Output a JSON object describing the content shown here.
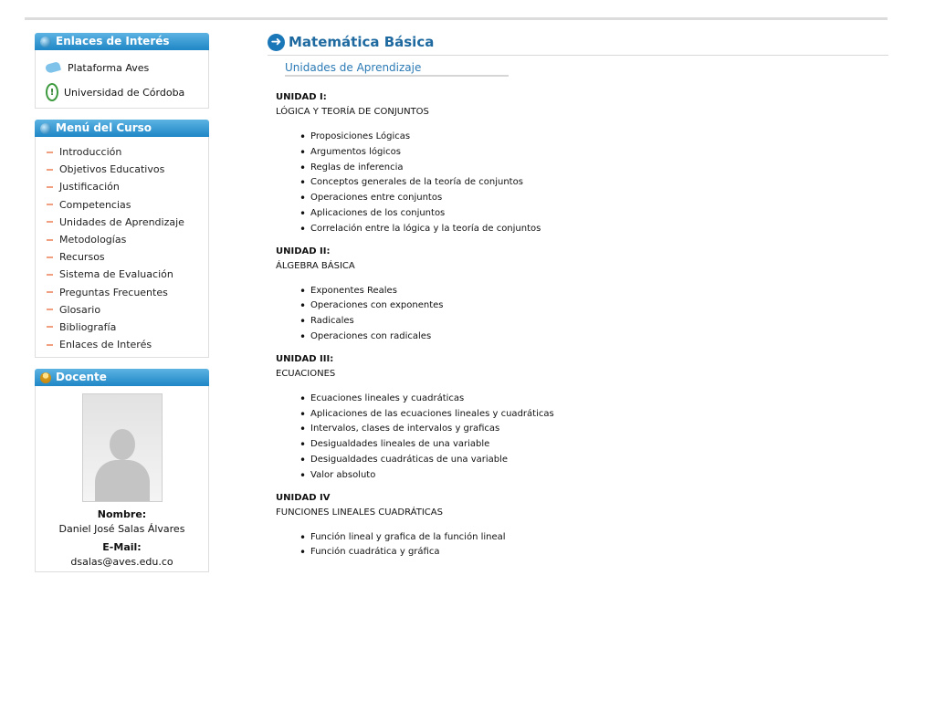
{
  "sidebar": {
    "links": {
      "title": "Enlaces de Interés",
      "items": [
        "Plataforma Aves",
        "Universidad de Córdoba"
      ]
    },
    "menu": {
      "title": "Menú del Curso",
      "items": [
        "Introducción",
        "Objetivos Educativos",
        "Justificación",
        "Competencias",
        "Unidades de Aprendizaje",
        "Metodologías",
        "Recursos",
        "Sistema de Evaluación",
        "Preguntas Frecuentes",
        "Glosario",
        "Bibliografía",
        "Enlaces de Interés"
      ]
    },
    "docente": {
      "title": "Docente",
      "name_label": "Nombre:",
      "name": "Daniel José Salas Álvares",
      "email_label": "E-Mail:",
      "email": "dsalas@aves.edu.co"
    }
  },
  "main": {
    "title": "Matemática Básica",
    "subtitle": "Unidades de Aprendizaje",
    "units": [
      {
        "heading": "UNIDAD  I:",
        "name": "LÓGICA Y TEORÍA DE CONJUNTOS",
        "topics": [
          "Proposiciones Lógicas",
          "Argumentos lógicos",
          "Reglas de inferencia",
          "Conceptos generales de la teoría de conjuntos",
          "Operaciones entre conjuntos",
          "Aplicaciones de los conjuntos",
          "Correlación entre la lógica y la teoría de conjuntos"
        ]
      },
      {
        "heading": "UNIDAD II:",
        "name": "ÁLGEBRA BÁSICA",
        "topics": [
          "Exponentes Reales",
          "Operaciones con exponentes",
          "Radicales",
          "Operaciones con radicales"
        ]
      },
      {
        "heading": "UNIDAD III:",
        "name": "ECUACIONES",
        "topics": [
          "Ecuaciones lineales y cuadráticas",
          "Aplicaciones de las ecuaciones lineales y cuadráticas",
          "Intervalos, clases de intervalos y graficas",
          "Desigualdades lineales de una variable",
          "Desigualdades cuadráticas de una variable",
          "Valor absoluto"
        ]
      },
      {
        "heading": "UNIDAD IV",
        "name": "FUNCIONES LINEALES CUADRÁTICAS",
        "topics": [
          "Función lineal y grafica de la función lineal",
          "Función cuadrática y gráfica"
        ]
      }
    ]
  },
  "colors": {
    "header_blue": "#1f86c6",
    "title_blue": "#1e6aa0",
    "menu_dash": "#f0a080"
  },
  "icons": {
    "links_header": "globe-icon",
    "menu_header": "globe-icon",
    "docente_header": "user-icon",
    "title": "arrow-right-circle-icon"
  }
}
